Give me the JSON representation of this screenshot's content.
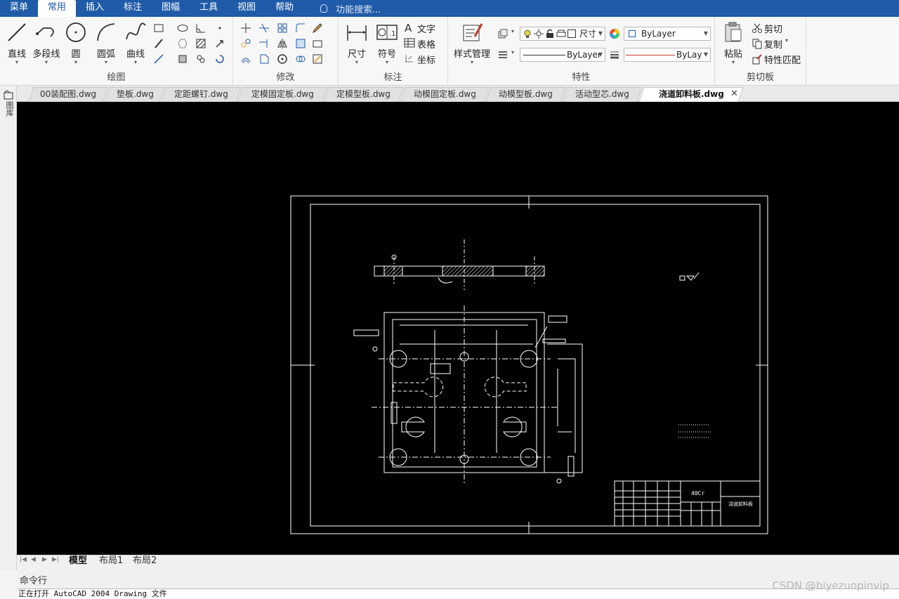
{
  "menu": {
    "items": [
      "菜单",
      "常用",
      "插入",
      "标注",
      "图幅",
      "工具",
      "视图",
      "帮助"
    ],
    "active_index": 1,
    "search_placeholder": "功能搜索..."
  },
  "ribbon": {
    "draw": {
      "label": "绘图",
      "tools": [
        "直线",
        "多段线",
        "圆",
        "圆弧",
        "曲线"
      ]
    },
    "modify": {
      "label": "修改"
    },
    "annotate": {
      "label": "标注",
      "dimension": "尺寸",
      "symbol": "符号",
      "text": "文字",
      "table": "表格",
      "coordinate": "坐标"
    },
    "properties": {
      "label": "特性",
      "style_manager": "样式管理",
      "layer_combo": "尺寸",
      "color_combo": "ByLayer",
      "linetype_combo": "ByLayer",
      "lineweight_combo": "ByLayer"
    },
    "clipboard": {
      "label": "剪切板",
      "paste": "粘贴",
      "cut": "剪切",
      "copy": "复制",
      "match": "特性匹配"
    }
  },
  "left_strip": {
    "label": "图库"
  },
  "tabs": [
    "00装配图.dwg",
    "垫板.dwg",
    "定距螺钉.dwg",
    "定模固定板.dwg",
    "定模型板.dwg",
    "动模固定板.dwg",
    "动模型板.dwg",
    "活动型芯.dwg",
    "浇道卸料板.dwg"
  ],
  "active_tab_index": 8,
  "drawing": {
    "material": "40Cr",
    "part_name": "浇道卸料板"
  },
  "layouts": [
    "模型",
    "布局1",
    "布局2"
  ],
  "active_layout_index": 0,
  "command": {
    "label": "命令行",
    "output": "正在打开 AutoCAD 2004 Drawing 文件"
  },
  "watermark": "CSDN @biyezuopinvip",
  "colors": {
    "menubar": "#1f5ba8",
    "canvas": "#000000",
    "lines": "#ffffff"
  }
}
